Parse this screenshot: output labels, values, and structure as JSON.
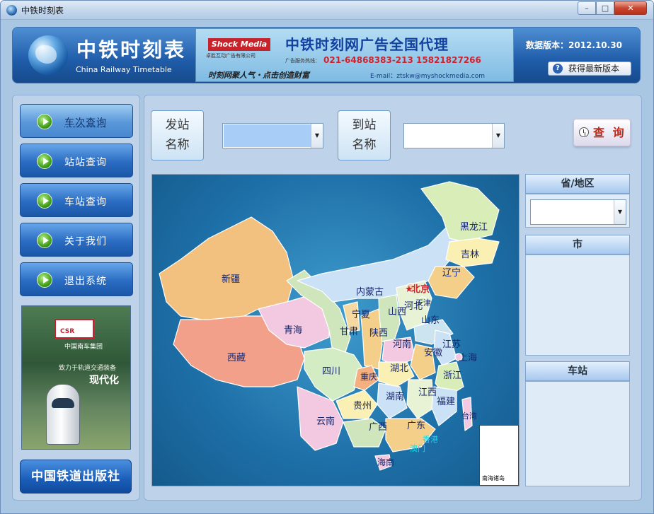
{
  "window": {
    "title": "中铁时刻表",
    "controls": {
      "minimize": "–",
      "maximize": "□",
      "close": "✕"
    }
  },
  "header": {
    "app_name": "中铁时刻表",
    "app_subtitle": "China Railway Timetable",
    "ad": {
      "logo": "Shock Media",
      "logo_sub": "卓胜互动广告有限公司",
      "title": "中铁时刻网广告全国代理",
      "hotline_label": "广告服务热线：",
      "phone": "021-64868383-213   15821827266",
      "slogan": "时刻网聚人气・点击创造财富",
      "email": "E-mail：ztskw@myshockmedia.com"
    },
    "version": "数据版本：2012.10.30",
    "update_button": "获得最新版本"
  },
  "nav": {
    "items": [
      {
        "label": "车次查询",
        "active": true
      },
      {
        "label": "站站查询",
        "active": false
      },
      {
        "label": "车站查询",
        "active": false
      },
      {
        "label": "关于我们",
        "active": false
      },
      {
        "label": "退出系统",
        "active": false
      }
    ],
    "promo": {
      "logo": "CSR",
      "group": "中国南车集团",
      "tagline": "致力于轨道交通装备",
      "headline": "现代化"
    },
    "publisher": "中国铁道出版社"
  },
  "search": {
    "from_label": "发站\n名称",
    "from_value": "",
    "to_label": "到站\n名称",
    "to_value": "",
    "query_button": "查 询"
  },
  "map": {
    "provinces": [
      "黑龙江",
      "吉林",
      "辽宁",
      "内蒙古",
      "北京",
      "天津",
      "河北",
      "山西",
      "山东",
      "新疆",
      "青海",
      "宁夏",
      "甘肃",
      "陕西",
      "河南",
      "江苏",
      "上海",
      "安徽",
      "西藏",
      "四川",
      "重庆",
      "湖北",
      "浙江",
      "湖南",
      "江西",
      "福建",
      "台湾",
      "贵州",
      "云南",
      "广西",
      "广东",
      "香港",
      "澳门",
      "海南"
    ],
    "inset_label": "南海诸岛",
    "capital": "北京"
  },
  "side": {
    "province_header": "省/地区",
    "province_value": "",
    "city_header": "市",
    "station_header": "车站"
  },
  "colors": {
    "header_blue": "#1f5ca9",
    "nav_blue": "#2a6cc2",
    "panel_bg": "#bed3ea",
    "query_text": "#c02a1b",
    "sea": "#1d6fa7"
  }
}
